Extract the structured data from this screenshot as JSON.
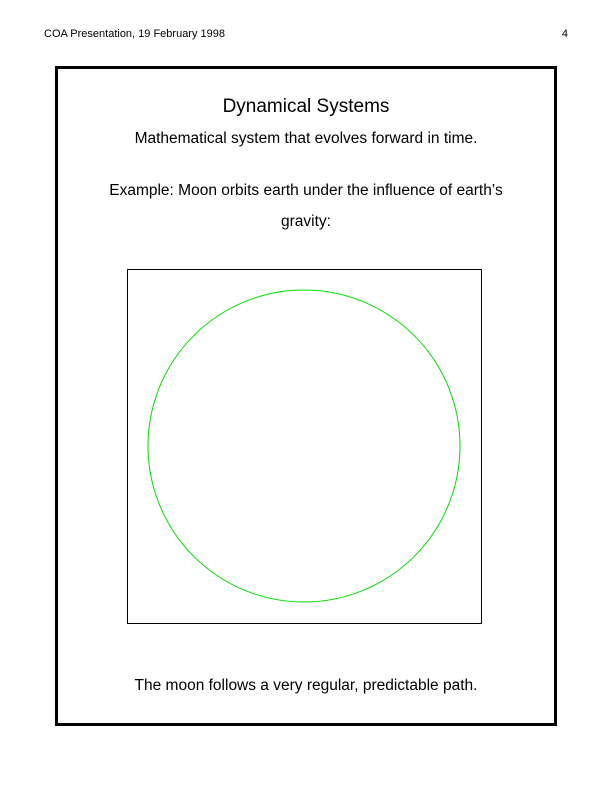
{
  "header": {
    "left_text": "COA Presentation, 19 February 1998",
    "page_number": "4"
  },
  "slide": {
    "title": "Dynamical Systems",
    "subtitle": "Mathematical system that evolves forward in time.",
    "example_line1": "Example: Moon orbits earth under the influence of earth’s",
    "example_line2": "gravity:",
    "caption": "The moon follows a very regular, predictable path."
  },
  "figure": {
    "orbit_color": "#00dd00",
    "frame_color": "#000000",
    "orbit_shape": "circle"
  }
}
